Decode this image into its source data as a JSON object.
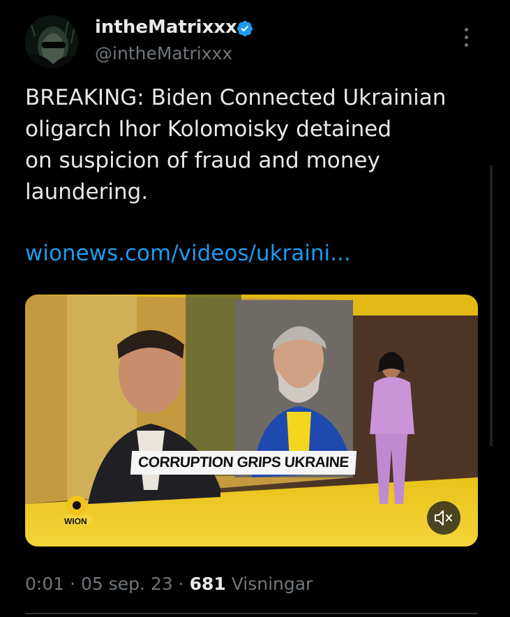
{
  "author": {
    "display_name": "intheMatrixxx",
    "handle": "@intheMatrixxx",
    "verified": true,
    "verified_color": "#1d9bf0"
  },
  "tweet": {
    "text_lines": [
      "BREAKING: Biden Connected Ukrainian",
      "oligarch Ihor Kolomoisky detained",
      "on suspicion of fraud and money",
      "laundering."
    ],
    "link_text": "wionews.com/videos/ukraini...",
    "link_color": "#1d9bf0"
  },
  "media": {
    "banner_text": "CORRUPTION GRIPS UKRAINE",
    "channel_logo_text": "WION",
    "mute_icon": "volume-muted-icon"
  },
  "meta": {
    "time": "0:01",
    "separator": " · ",
    "date": "05 sep. 23",
    "views_count": "681",
    "views_label": " Visningar"
  },
  "icons": {
    "more": "more-vertical-icon",
    "verified": "verified-badge-icon"
  }
}
